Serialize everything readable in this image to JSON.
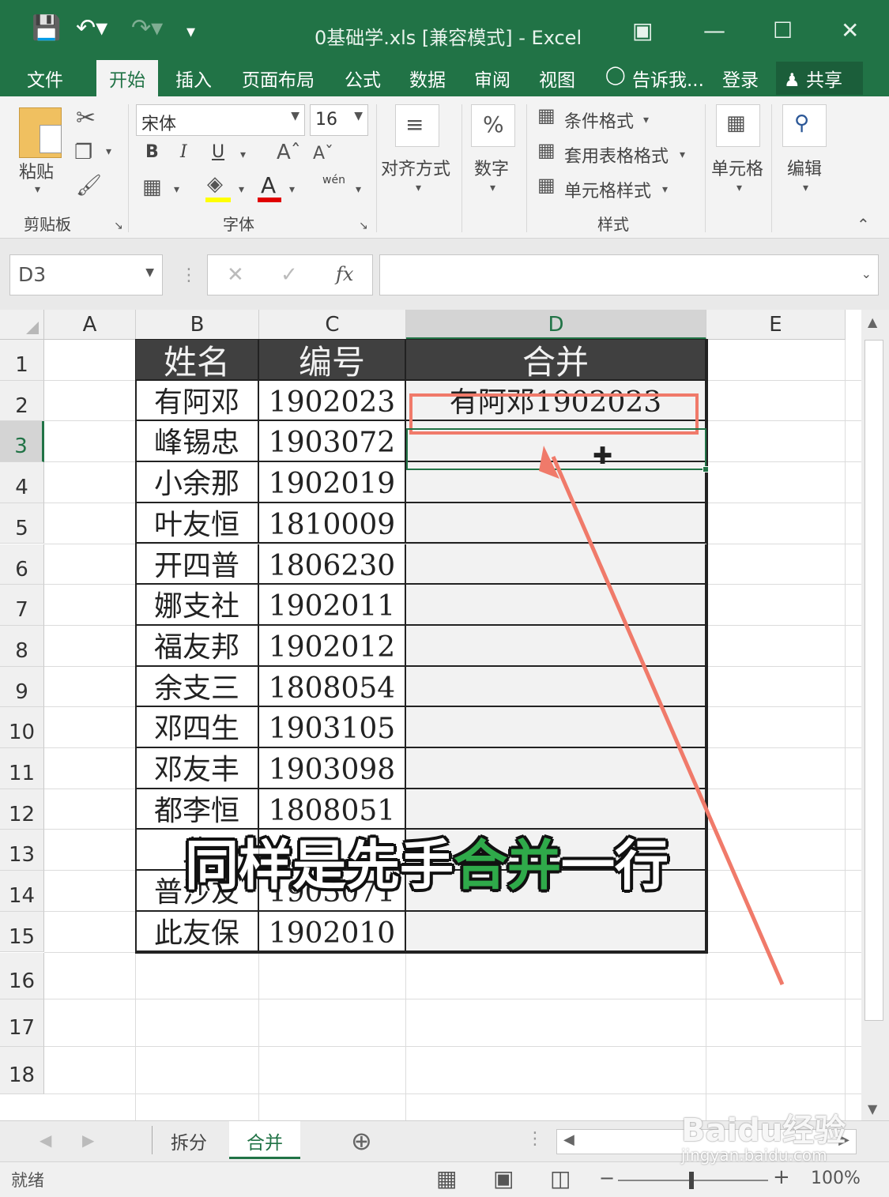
{
  "window": {
    "title": "0基础学.xls  [兼容模式] - Excel"
  },
  "ribbon_tabs": [
    "文件",
    "开始",
    "插入",
    "页面布局",
    "公式",
    "数据",
    "审阅",
    "视图",
    "告诉我...",
    "登录",
    "共享"
  ],
  "active_tab": "开始",
  "ribbon": {
    "paste_label": "粘贴",
    "clipboard_group": "剪贴板",
    "font_name": "宋体",
    "font_size": "16",
    "bold": "B",
    "italic": "I",
    "underline": "U",
    "font_group": "字体",
    "wen": "wén",
    "align_label": "对齐方式",
    "number_label": "数字",
    "percent": "%",
    "cond_format": "条件格式",
    "table_format": "套用表格格式",
    "cell_style": "单元格样式",
    "styles_group": "样式",
    "cells_label": "单元格",
    "edit_label": "编辑"
  },
  "formula_bar": {
    "name_box": "D3",
    "fx": "fx",
    "formula": ""
  },
  "columns": [
    "A",
    "B",
    "C",
    "D",
    "E"
  ],
  "rows": [
    "1",
    "2",
    "3",
    "4",
    "5",
    "6",
    "7",
    "8",
    "9",
    "10",
    "11",
    "12",
    "13",
    "14",
    "15",
    "16",
    "17",
    "18"
  ],
  "table": {
    "headers": [
      "姓名",
      "编号",
      "合并"
    ],
    "rows": [
      [
        "有阿邓",
        "1902023",
        "有阿邓1902023"
      ],
      [
        "峰锡忠",
        "1903072",
        ""
      ],
      [
        "小余那",
        "1902019",
        ""
      ],
      [
        "叶友恒",
        "1810009",
        ""
      ],
      [
        "开四普",
        "1806230",
        ""
      ],
      [
        "娜支社",
        "1902011",
        ""
      ],
      [
        "福友邦",
        "1902012",
        ""
      ],
      [
        "余支三",
        "1808054",
        ""
      ],
      [
        "邓四生",
        "1903105",
        ""
      ],
      [
        "邓友丰",
        "1903098",
        ""
      ],
      [
        "都李恒",
        "1808051",
        ""
      ],
      [
        "此",
        "",
        ""
      ],
      [
        "普沙友",
        "1903071",
        ""
      ],
      [
        "此友保",
        "1902010",
        ""
      ]
    ]
  },
  "sheet_tabs": [
    "拆分",
    "合并"
  ],
  "active_sheet": "合并",
  "status": {
    "ready": "就绪",
    "zoom": "100%"
  },
  "caption": {
    "part1": "同样是先手",
    "highlight": "合并",
    "part2": "一行"
  },
  "watermark": {
    "logo": "Baidu经验",
    "url": "jingyan.baidu.com"
  },
  "colors": {
    "excel_green": "#217346",
    "header_fill": "#404040",
    "annotation": "#f07a6a",
    "caption_highlight": "#2faa4a"
  }
}
